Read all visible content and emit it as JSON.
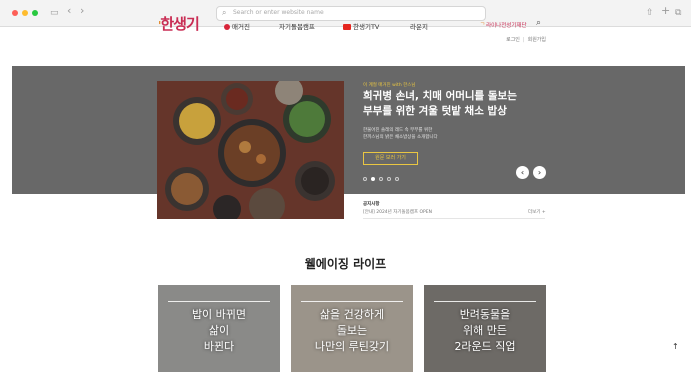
{
  "browser": {
    "url_placeholder": "Search or enter website name",
    "back_glyph": "‹",
    "forward_glyph": "›",
    "sidebar_glyph": "▭",
    "share_glyph": "⇧",
    "newtab_glyph": "+",
    "tabs_glyph": "⧉"
  },
  "header": {
    "logo_pre": "'",
    "logo": "한생기",
    "util_login": "로그인",
    "util_join": "회원가입",
    "nav": [
      {
        "label": "매거진"
      },
      {
        "label": "자기돌봄캠프"
      },
      {
        "label": "한생기TV"
      },
      {
        "label": "라운지"
      }
    ],
    "foundation": "라이나전성기재단",
    "foundation_mark": "ᄀ",
    "search_glyph": "⌕"
  },
  "hero": {
    "eyebrow": "이 계절 매거진 with 한스님",
    "title_line1": "희귀병 손녀, 치매 어머니를 돌보는",
    "title_line2": "부부를 위한 겨울 텃밭 채소 밥상",
    "desc_line1": "한물어진 솔레의 레드 속 부부를 위한",
    "desc_line2": "한끼스님의 밝은 채소밥상을 소개합니다",
    "button": "원문 보러 가기",
    "slides_total": 5,
    "active_slide": 2,
    "prev_glyph": "‹",
    "next_glyph": "›"
  },
  "notice": {
    "label": "공지사항",
    "text": "[안내] 2024년 자기돌봄캠프 OPEN",
    "more": "더보기 +"
  },
  "section": {
    "title": "웰에이징 라이프"
  },
  "cards": [
    {
      "line1": "밥이 바뀌면",
      "line2": "삶이",
      "line3": "바뀐다",
      "bg": "#8a8a88"
    },
    {
      "line1": "삶을 건강하게",
      "line2": "돌보는",
      "line3": "나만의 루틴갖기",
      "bg": "#9b948a"
    },
    {
      "line1": "반려동물을",
      "line2": "위해 만든",
      "line3": "2라운드 직업",
      "bg": "#6d6a66"
    }
  ],
  "back_to_top": "↑"
}
